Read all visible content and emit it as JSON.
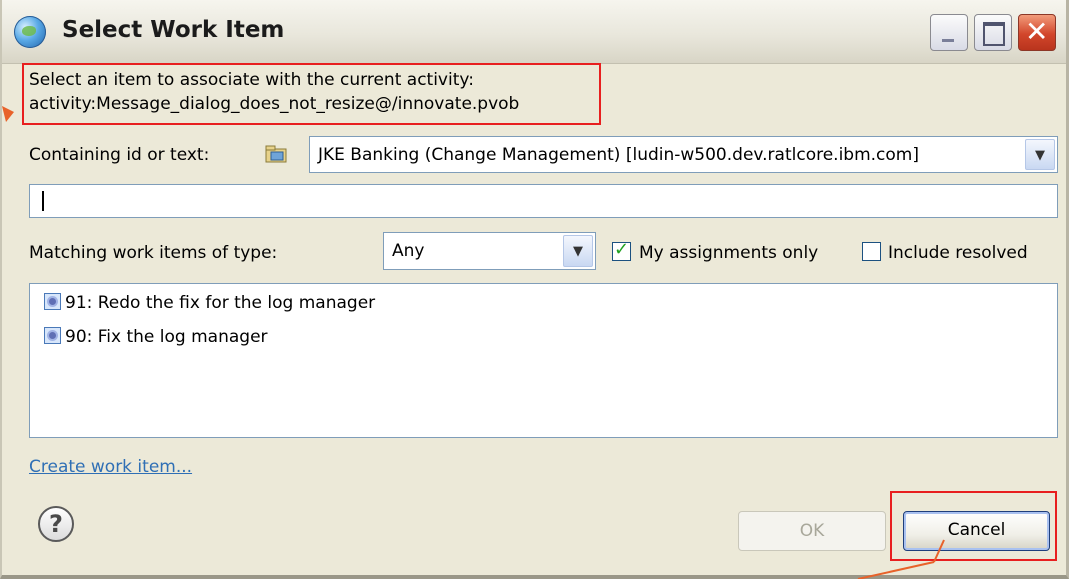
{
  "window": {
    "title": "Select Work Item"
  },
  "instructions": {
    "line1": "Select an item to associate with the current activity:",
    "line2": "activity:Message_dialog_does_not_resize@/innovate.pvob"
  },
  "search": {
    "containing_label": "Containing id or text:",
    "repository_value": "JKE Banking (Change Management) [ludin-w500.dev.ratlcore.ibm.com]",
    "text_value": ""
  },
  "filters": {
    "type_label": "Matching work items of type:",
    "type_value": "Any",
    "my_assignments_label": "My assignments only",
    "my_assignments_checked": true,
    "include_resolved_label": "Include resolved",
    "include_resolved_checked": false
  },
  "work_items": [
    {
      "label": "91: Redo the fix for the log manager"
    },
    {
      "label": "90: Fix the log manager"
    }
  ],
  "links": {
    "create": "Create work item..."
  },
  "buttons": {
    "ok": "OK",
    "cancel": "Cancel"
  },
  "icons": {
    "title": "globe-icon",
    "repository": "repository-icon",
    "work_item": "work-item-icon",
    "help": "help-icon"
  },
  "colors": {
    "annotation_red": "#e81f1f",
    "arrow_orange": "#e8622a",
    "link_blue": "#2f6fb5",
    "check_green": "#21a121"
  }
}
